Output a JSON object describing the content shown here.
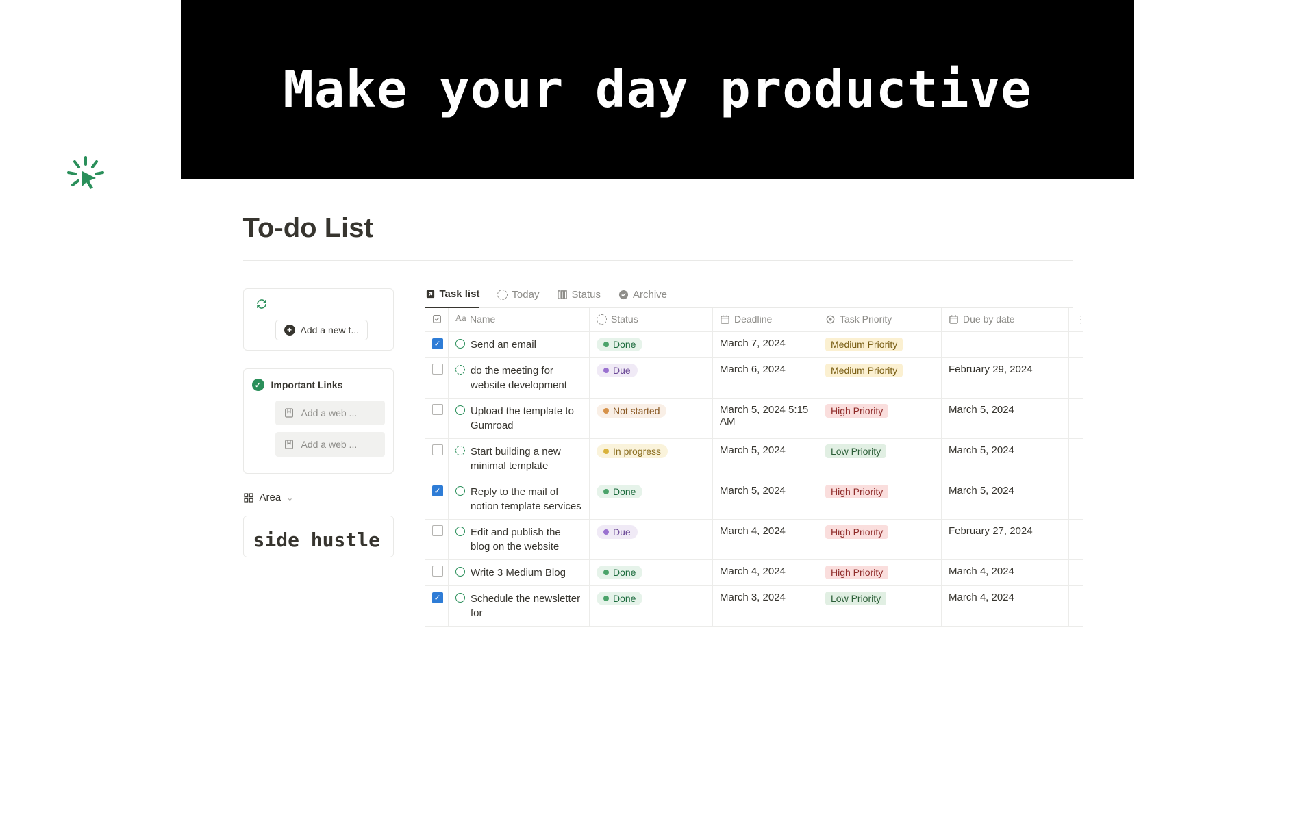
{
  "hero": {
    "title": "Make your day productive"
  },
  "page": {
    "title": "To-do List"
  },
  "sidebar": {
    "addNewTask": "Add a new t...",
    "importantLinks": {
      "title": "Important Links",
      "placeholder": "Add a web ..."
    },
    "area": {
      "label": "Area"
    },
    "sideHustle": "side hustle"
  },
  "tabs": [
    {
      "id": "tasklist",
      "label": "Task list",
      "active": true
    },
    {
      "id": "today",
      "label": "Today",
      "active": false
    },
    {
      "id": "status",
      "label": "Status",
      "active": false
    },
    {
      "id": "archive",
      "label": "Archive",
      "active": false
    }
  ],
  "columns": {
    "name": "Name",
    "status": "Status",
    "deadline": "Deadline",
    "priority": "Task Priority",
    "dueBy": "Due by date"
  },
  "statusStyles": {
    "Done": "pill-done",
    "Due": "pill-due",
    "Not started": "pill-notstarted",
    "In progress": "pill-inprogress"
  },
  "priorityStyles": {
    "Medium Priority": "tag-medium",
    "High Priority": "tag-high",
    "Low Priority": "tag-low"
  },
  "rows": [
    {
      "checked": true,
      "iconDashed": false,
      "name": "Send an email",
      "status": "Done",
      "deadline": "March 7, 2024",
      "priority": "Medium Priority",
      "dueBy": ""
    },
    {
      "checked": false,
      "iconDashed": true,
      "name": "do the meeting for website development",
      "status": "Due",
      "deadline": "March 6, 2024",
      "priority": "Medium Priority",
      "dueBy": "February 29, 2024"
    },
    {
      "checked": false,
      "iconDashed": false,
      "name": "Upload the template to Gumroad",
      "status": "Not started",
      "deadline": "March 5, 2024 5:15 AM",
      "priority": "High Priority",
      "dueBy": "March 5, 2024"
    },
    {
      "checked": false,
      "iconDashed": true,
      "name": "Start building a new minimal template",
      "status": "In progress",
      "deadline": "March 5, 2024",
      "priority": "Low Priority",
      "dueBy": "March 5, 2024"
    },
    {
      "checked": true,
      "iconDashed": false,
      "name": "Reply to the mail of notion template services",
      "status": "Done",
      "deadline": "March 5, 2024",
      "priority": "High Priority",
      "dueBy": "March 5, 2024"
    },
    {
      "checked": false,
      "iconDashed": false,
      "name": "Edit and publish the blog on the website",
      "status": "Due",
      "deadline": "March 4, 2024",
      "priority": "High Priority",
      "dueBy": "February 27, 2024"
    },
    {
      "checked": false,
      "iconDashed": false,
      "name": "Write 3 Medium Blog",
      "status": "Done",
      "deadline": "March 4, 2024",
      "priority": "High Priority",
      "dueBy": "March 4, 2024"
    },
    {
      "checked": true,
      "iconDashed": false,
      "name": "Schedule the newsletter for",
      "status": "Done",
      "deadline": "March 3, 2024",
      "priority": "Low Priority",
      "dueBy": "March 4, 2024"
    }
  ]
}
